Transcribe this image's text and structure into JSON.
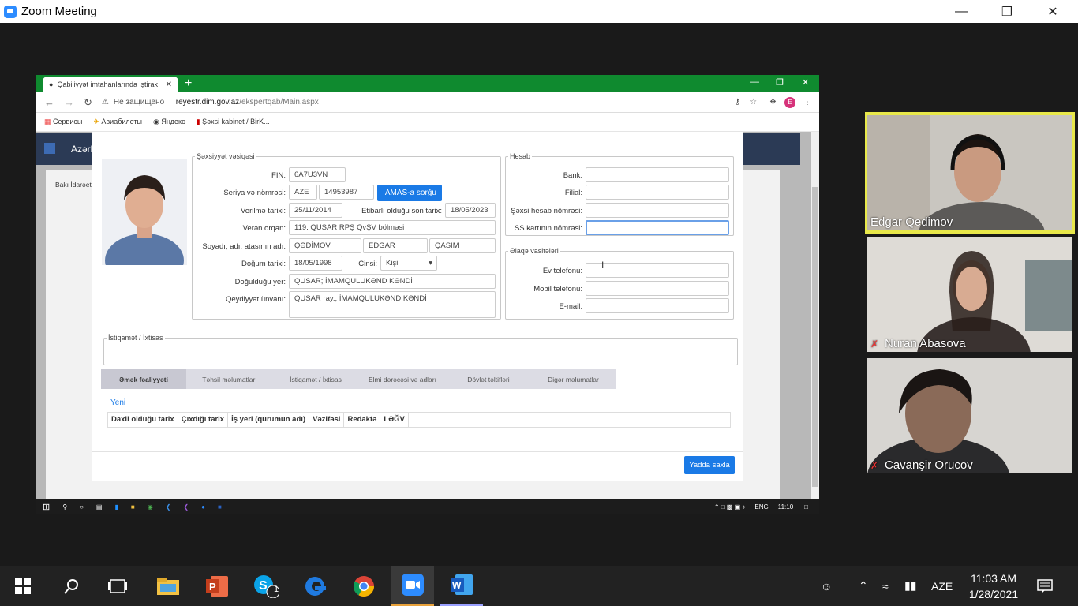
{
  "zoom": {
    "title": "Zoom Meeting"
  },
  "browser": {
    "tab_title": "Qabiliyyət imtahanlarında iştirak",
    "not_secure": "Не защищено",
    "url_host": "reyestr.dim.gov.az",
    "url_path": "/ekspertqab/Main.aspx",
    "profile_letter": "E",
    "bookmarks": [
      "Сервисы",
      "Авиабилеты",
      "Яндекс",
      "Şəxsi kabinet / BirK..."
    ]
  },
  "page": {
    "brand": "Azərb",
    "side_item": "Bakı İdarəet"
  },
  "form": {
    "id_legend": "Şəxsiyyət vəsiqəsi",
    "fin_label": "FIN:",
    "fin": "6A7U3VN",
    "seria_label": "Seriya və nömrəsi:",
    "seria": "AZE",
    "nomre": "14953987",
    "iamas_btn": "İAMAS-a sorğu",
    "issue_label": "Verilmə tarixi:",
    "issue": "25/11/2014",
    "valid_label": "Etibarlı olduğu son tarix:",
    "valid": "18/05/2023",
    "organ_label": "Verən orqan:",
    "organ": "119. QUSAR  RPŞ QvŞV bölməsi",
    "name_label": "Soyadı, adı, atasının adı:",
    "surname": "QƏDİMOV",
    "name": "EDGAR",
    "father": "QASIM",
    "birth_label": "Doğum tarixi:",
    "birth": "18/05/1998",
    "gender_label": "Cinsi:",
    "gender": "Kişi",
    "birthplace_label": "Doğulduğu yer:",
    "birthplace": "QUSAR; İMAMQULUKƏND KƏNDİ",
    "addr_label": "Qeydiyyat ünvanı:",
    "addr": "QUSAR ray., İMAMQULUKƏND KƏNDİ",
    "bank_legend": "Hesab",
    "bank_label": "Bank:",
    "filial_label": "Filial:",
    "acct_label": "Şəxsi hesab nömrəsi:",
    "card_label": "SS kartının nömrəsi:",
    "contact_legend": "Əlaqə vasitələri",
    "home_label": "Ev telefonu:",
    "mobile_label": "Mobil telefonu:",
    "email_label": "E-mail:",
    "direction_legend": "İstiqamət / İxtisas",
    "tabs": [
      "Əmək fəaliyyəti",
      "Təhsil məlumatları",
      "İstiqamət / İxtisas",
      "Elmi dərəcəsi və adları",
      "Dövlət təltifləri",
      "Digər məlumatlar"
    ],
    "new_link": "Yeni",
    "columns": [
      "Daxil olduğu tarix",
      "Çıxdığı tarix",
      "İş yeri (qurumun adı)",
      "Vəzifəsi",
      "Redaktə",
      "LƏĞV"
    ],
    "save_btn": "Yadda saxla"
  },
  "vm_taskbar": {
    "lang": "ENG",
    "time": "11:10"
  },
  "participants": [
    {
      "name": "Edgar Qedimov"
    },
    {
      "name": "Nuran Abasova"
    },
    {
      "name": "Cavanşir Orucov"
    }
  ],
  "taskbar": {
    "lang": "AZE",
    "time": "11:03 AM",
    "date": "1/28/2021",
    "skype_badge": "1"
  },
  "colors": {
    "chrome": "#0f8a2f",
    "accent": "#1a7ae6",
    "zoom": "#2d8cff",
    "active_speaker": "#e8e84a"
  }
}
